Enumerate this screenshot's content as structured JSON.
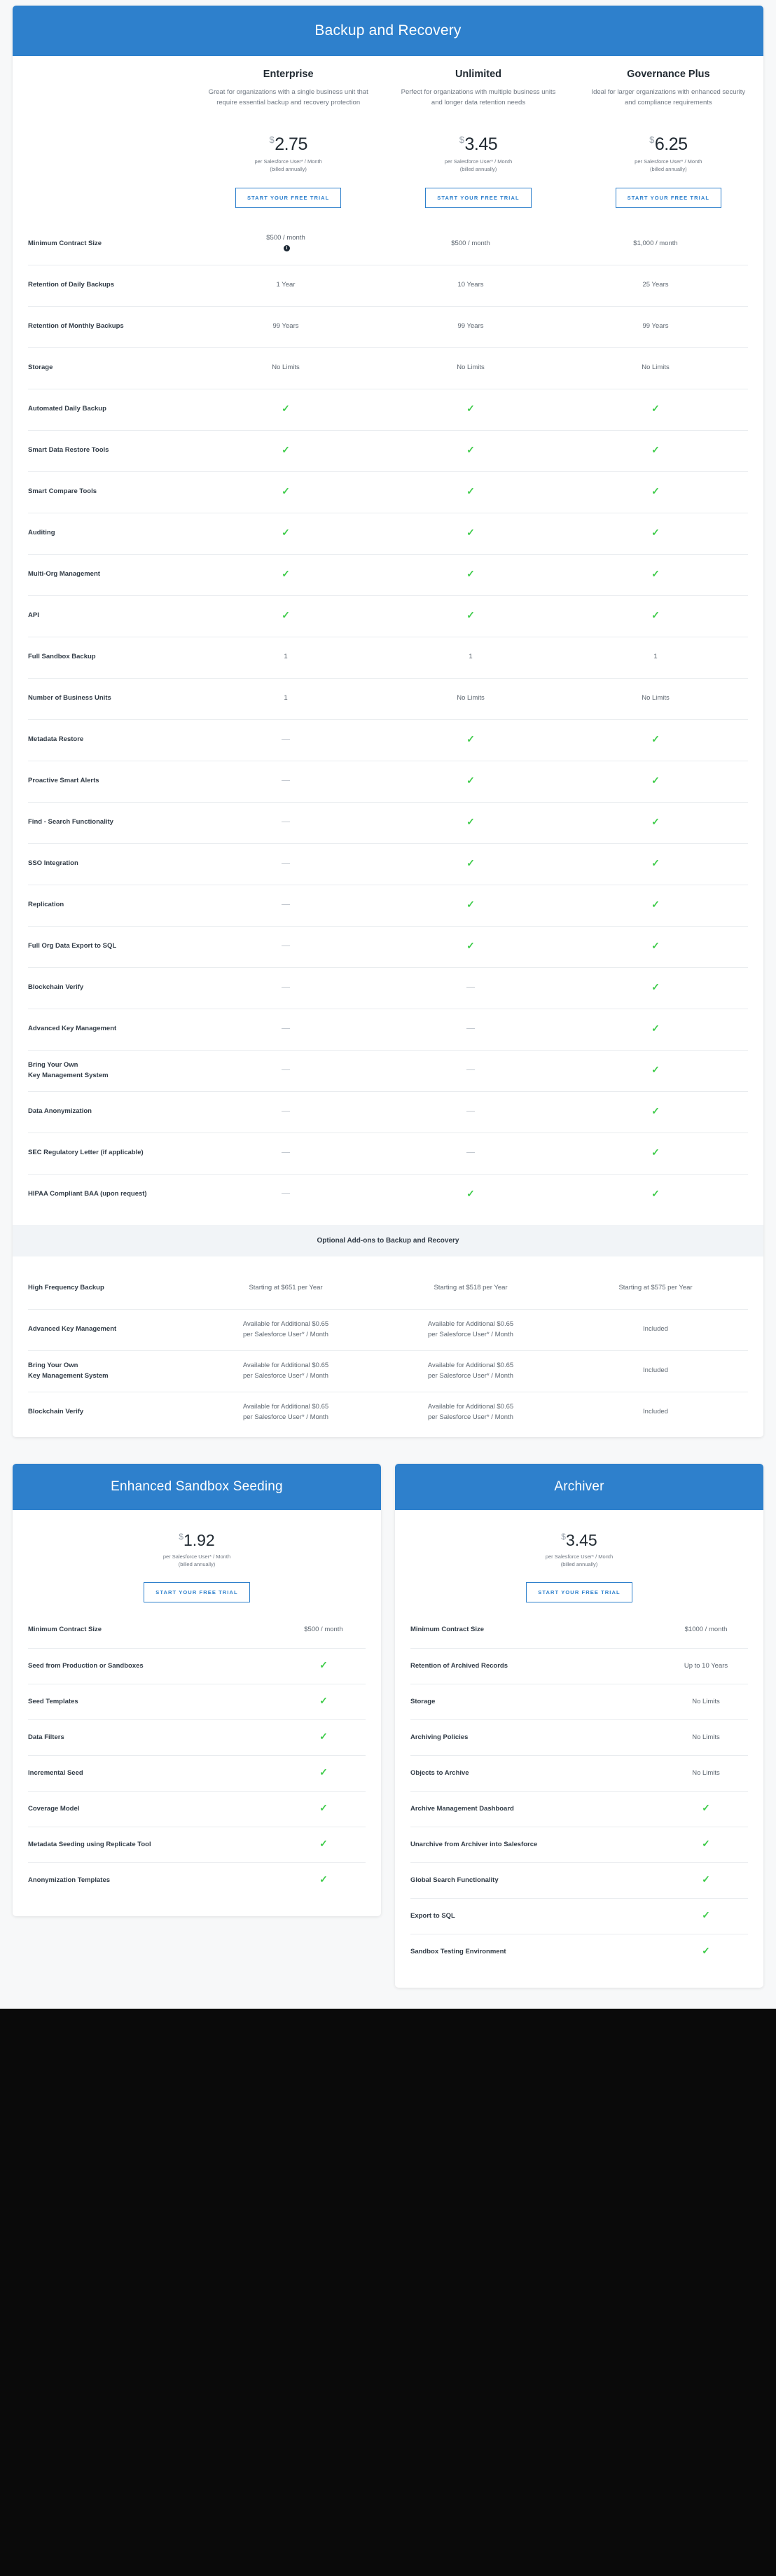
{
  "main_card": {
    "title": "Backup and Recovery",
    "plans": [
      {
        "name": "Enterprise",
        "description": "Great for organizations with a single business unit that require essential backup and recovery protection",
        "currency": "$",
        "price": "2.75",
        "unit_line1": "per Salesforce User* / Month",
        "unit_line2": "(billed annually)",
        "cta": "START YOUR FREE TRIAL"
      },
      {
        "name": "Unlimited",
        "description": "Perfect for organizations with multiple business units and longer data retention needs",
        "currency": "$",
        "price": "3.45",
        "unit_line1": "per Salesforce User* / Month",
        "unit_line2": "(billed annually)",
        "cta": "START YOUR FREE TRIAL"
      },
      {
        "name": "Governance Plus",
        "description": "Ideal for larger organizations with enhanced security and compliance requirements",
        "currency": "$",
        "price": "6.25",
        "unit_line1": "per Salesforce User* / Month",
        "unit_line2": "(billed annually)",
        "cta": "START YOUR FREE TRIAL"
      }
    ],
    "features": [
      {
        "label": "Minimum Contract Size",
        "values": [
          "$500 / month",
          "$500 / month",
          "$1,000 / month"
        ],
        "info_icon_on": 0
      },
      {
        "label": "Retention of Daily Backups",
        "values": [
          "1 Year",
          "10 Years",
          "25 Years"
        ]
      },
      {
        "label": "Retention of Monthly Backups",
        "values": [
          "99 Years",
          "99 Years",
          "99 Years"
        ]
      },
      {
        "label": "Storage",
        "values": [
          "No Limits",
          "No Limits",
          "No Limits"
        ]
      },
      {
        "label": "Automated Daily Backup",
        "values": [
          "check",
          "check",
          "check"
        ]
      },
      {
        "label": "Smart Data Restore Tools",
        "values": [
          "check",
          "check",
          "check"
        ]
      },
      {
        "label": "Smart Compare Tools",
        "values": [
          "check",
          "check",
          "check"
        ]
      },
      {
        "label": "Auditing",
        "values": [
          "check",
          "check",
          "check"
        ]
      },
      {
        "label": "Multi-Org Management",
        "values": [
          "check",
          "check",
          "check"
        ]
      },
      {
        "label": "API",
        "values": [
          "check",
          "check",
          "check"
        ]
      },
      {
        "label": "Full Sandbox Backup",
        "values": [
          "1",
          "1",
          "1"
        ]
      },
      {
        "label": "Number of Business Units",
        "values": [
          "1",
          "No Limits",
          "No Limits"
        ]
      },
      {
        "label": "Metadata Restore",
        "values": [
          "dash",
          "check",
          "check"
        ]
      },
      {
        "label": "Proactive Smart Alerts",
        "values": [
          "dash",
          "check",
          "check"
        ]
      },
      {
        "label": "Find - Search Functionality",
        "values": [
          "dash",
          "check",
          "check"
        ]
      },
      {
        "label": "SSO Integration",
        "values": [
          "dash",
          "check",
          "check"
        ]
      },
      {
        "label": "Replication",
        "values": [
          "dash",
          "check",
          "check"
        ]
      },
      {
        "label": "Full Org Data Export to SQL",
        "values": [
          "dash",
          "check",
          "check"
        ]
      },
      {
        "label": "Blockchain Verify",
        "values": [
          "dash",
          "dash",
          "check"
        ]
      },
      {
        "label": "Advanced Key Management",
        "values": [
          "dash",
          "dash",
          "check"
        ]
      },
      {
        "label": "Bring Your Own\nKey Management System",
        "values": [
          "dash",
          "dash",
          "check"
        ]
      },
      {
        "label": "Data Anonymization",
        "values": [
          "dash",
          "dash",
          "check"
        ]
      },
      {
        "label": "SEC Regulatory Letter (if applicable)",
        "values": [
          "dash",
          "dash",
          "check"
        ]
      },
      {
        "label": "HIPAA Compliant BAA (upon request)",
        "values": [
          "dash",
          "check",
          "check"
        ]
      }
    ],
    "addons_banner": "Optional Add-ons to Backup and Recovery",
    "addons": [
      {
        "label": "High Frequency Backup",
        "values": [
          "Starting at $651 per Year",
          "Starting at $518 per Year",
          "Starting at $575 per Year"
        ]
      },
      {
        "label": "Advanced Key Management",
        "values": [
          "Available for Additional $0.65\nper Salesforce User* / Month",
          "Available for Additional $0.65\nper Salesforce User* / Month",
          "Included"
        ]
      },
      {
        "label": "Bring Your Own\nKey Management System",
        "values": [
          "Available for Additional $0.65\nper Salesforce User* / Month",
          "Available for Additional $0.65\nper Salesforce User* / Month",
          "Included"
        ]
      },
      {
        "label": "Blockchain Verify",
        "values": [
          "Available for Additional $0.65\nper Salesforce User* / Month",
          "Available for Additional $0.65\nper Salesforce User* / Month",
          "Included"
        ]
      }
    ]
  },
  "sandbox_card": {
    "title": "Enhanced Sandbox Seeding",
    "currency": "$",
    "price": "1.92",
    "unit_line1": "per Salesforce User* / Month",
    "unit_line2": "(billed annually)",
    "cta": "START YOUR FREE TRIAL",
    "features": [
      {
        "label": "Minimum Contract Size",
        "value": "$500 / month"
      },
      {
        "label": "Seed from Production or Sandboxes",
        "value": "check"
      },
      {
        "label": "Seed Templates",
        "value": "check"
      },
      {
        "label": "Data Filters",
        "value": "check"
      },
      {
        "label": "Incremental Seed",
        "value": "check"
      },
      {
        "label": "Coverage Model",
        "value": "check"
      },
      {
        "label": "Metadata Seeding using Replicate Tool",
        "value": "check"
      },
      {
        "label": "Anonymization Templates",
        "value": "check"
      }
    ]
  },
  "archiver_card": {
    "title": "Archiver",
    "currency": "$",
    "price": "3.45",
    "unit_line1": "per Salesforce User* / Month",
    "unit_line2": "(billed annually)",
    "cta": "START YOUR FREE TRIAL",
    "features": [
      {
        "label": "Minimum Contract Size",
        "value": "$1000 / month"
      },
      {
        "label": "Retention of Archived Records",
        "value": "Up to 10 Years"
      },
      {
        "label": "Storage",
        "value": "No Limits"
      },
      {
        "label": "Archiving Policies",
        "value": "No Limits"
      },
      {
        "label": "Objects to Archive",
        "value": "No Limits"
      },
      {
        "label": "Archive Management Dashboard",
        "value": "check"
      },
      {
        "label": "Unarchive from Archiver into Salesforce",
        "value": "check"
      },
      {
        "label": "Global Search Functionality",
        "value": "check"
      },
      {
        "label": "Export to SQL",
        "value": "check"
      },
      {
        "label": "Sandbox Testing Environment",
        "value": "check"
      }
    ]
  },
  "colors": {
    "brand_blue": "#2e80cc",
    "check_green": "#3fcc4b",
    "text_dark": "#323c47",
    "text_muted": "#6f7782",
    "page_bg": "#f7f8f9",
    "divider": "#e9ecef"
  },
  "icons": {
    "check": "✓",
    "info": "i"
  }
}
